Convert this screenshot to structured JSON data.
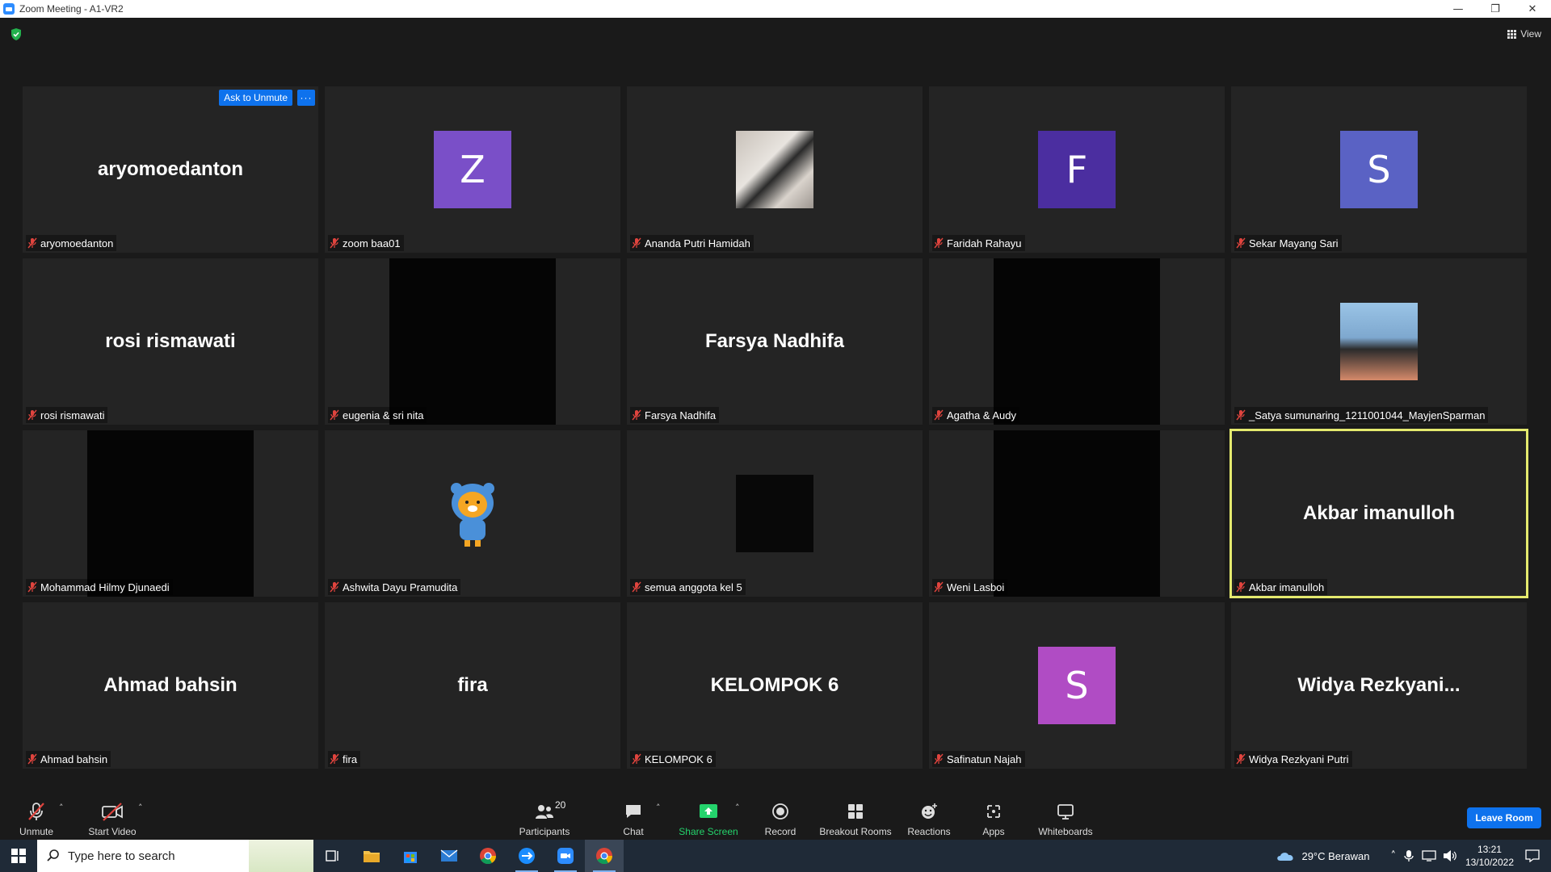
{
  "window": {
    "title": "Zoom Meeting - A1-VR2"
  },
  "top": {
    "view_label": "View"
  },
  "tiles": [
    {
      "display": "aryomoedanton",
      "label": "aryomoedanton",
      "kind": "name",
      "ask_unmute": "Ask to Unmute"
    },
    {
      "display": "Z",
      "label": "zoom baa01",
      "kind": "avatar",
      "color": "#7a4fc8"
    },
    {
      "display": "",
      "label": "Ananda Putri Hamidah",
      "kind": "photo",
      "style": "photo-couple"
    },
    {
      "display": "F",
      "label": "Faridah Rahayu",
      "kind": "avatar",
      "color": "#4b2ea0"
    },
    {
      "display": "S",
      "label": "Sekar Mayang Sari",
      "kind": "avatar",
      "color": "#5a62c4"
    },
    {
      "display": "rosi rismawati",
      "label": "rosi rismawati",
      "kind": "name"
    },
    {
      "display": "",
      "label": "eugenia & sri nita",
      "kind": "video",
      "style": "trees"
    },
    {
      "display": "Farsya Nadhifa",
      "label": "Farsya Nadhifa",
      "kind": "name"
    },
    {
      "display": "",
      "label": "Agatha & Audy",
      "kind": "video",
      "style": "black"
    },
    {
      "display": "",
      "label": "_Satya sumunaring_1211001044_MayjenSparman",
      "kind": "photo",
      "style": "satya"
    },
    {
      "display": "",
      "label": "Mohammad Hilmy Djunaedi",
      "kind": "video",
      "style": "black"
    },
    {
      "display": "",
      "label": "Ashwita Dayu Pramudita",
      "kind": "bear"
    },
    {
      "display": "",
      "label": "semua anggota kel 5",
      "kind": "photo",
      "style": "starfield"
    },
    {
      "display": "",
      "label": "Weni Lasboi",
      "kind": "video",
      "style": "black"
    },
    {
      "display": "Akbar imanulloh",
      "label": "Akbar imanulloh",
      "kind": "name",
      "active": true
    },
    {
      "display": "Ahmad bahsin",
      "label": "Ahmad bahsin",
      "kind": "name"
    },
    {
      "display": "fira",
      "label": "fira",
      "kind": "name"
    },
    {
      "display": "KELOMPOK 6",
      "label": "KELOMPOK 6",
      "kind": "name"
    },
    {
      "display": "S",
      "label": "Safinatun Najah",
      "kind": "avatar",
      "color": "#b04cc4"
    },
    {
      "display": "Widya  Rezkyani...",
      "label": "Widya Rezkyani Putri",
      "kind": "name"
    }
  ],
  "toolbar": {
    "unmute": "Unmute",
    "start_video": "Start Video",
    "participants": "Participants",
    "participants_count": "20",
    "chat": "Chat",
    "share_screen": "Share Screen",
    "record": "Record",
    "breakout_rooms": "Breakout Rooms",
    "reactions": "Reactions",
    "apps": "Apps",
    "whiteboards": "Whiteboards",
    "leave": "Leave Room"
  },
  "taskbar": {
    "search_placeholder": "Type here to search",
    "weather": "29°C  Berawan",
    "time": "13:21",
    "date": "13/10/2022"
  },
  "colors": {
    "accent": "#0e72ed",
    "active_speaker": "#e4ea6e",
    "share_green": "#24d36c",
    "muted_red": "#e0443e"
  }
}
